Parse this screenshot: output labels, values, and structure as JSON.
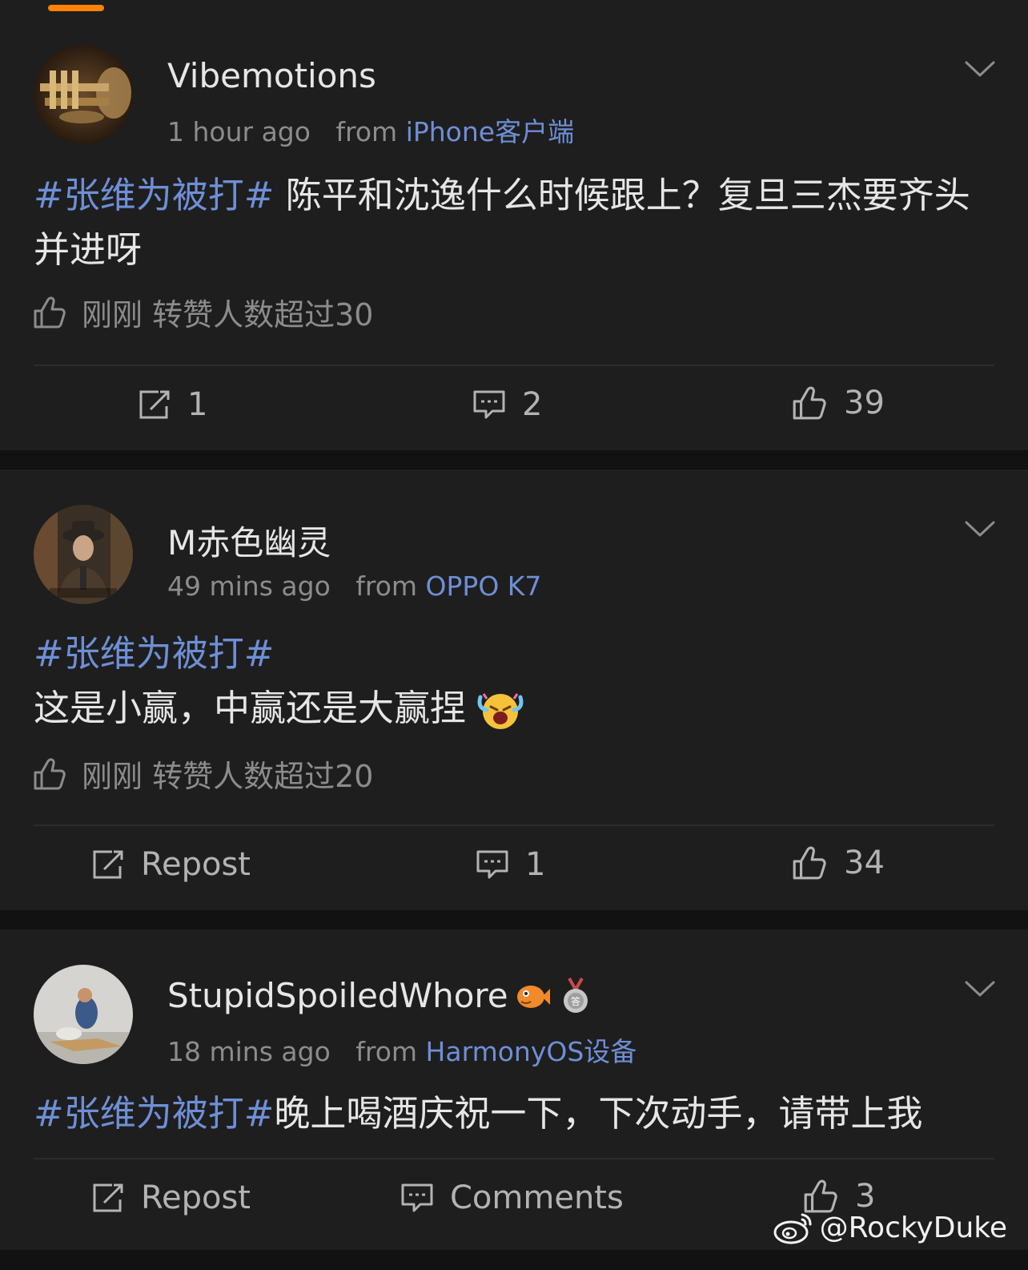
{
  "brand": {
    "accent": "#ff8200",
    "link": "#6e8fd6"
  },
  "watermark": "@RockyDuke",
  "posts": [
    {
      "username": "Vibemotions",
      "time": "1 hour ago",
      "from_label": "from",
      "source": "iPhone客户端",
      "hashtag": "#张维为被打#",
      "text": "陈平和沈逸什么时候跟上？复旦三杰要齐头并进呀",
      "like_note": "刚刚 转赞人数超过30",
      "repost": "1",
      "comments": "2",
      "likes": "39"
    },
    {
      "username": "M赤色幽灵",
      "time": "49 mins ago",
      "from_label": "from",
      "source": "OPPO K7",
      "hashtag": "#张维为被打#",
      "text": "这是小赢，中赢还是大赢捏",
      "like_note": "刚刚 转赞人数超过20",
      "repost": "Repost",
      "comments": "1",
      "likes": "34"
    },
    {
      "username": "StupidSpoiledWhore",
      "time": "18 mins ago",
      "from_label": "from",
      "source": "HarmonyOS设备",
      "hashtag": "#张维为被打#",
      "text": "晚上喝酒庆祝一下，下次动手，请带上我",
      "repost": "Repost",
      "comments": "Comments",
      "likes": "3"
    }
  ]
}
